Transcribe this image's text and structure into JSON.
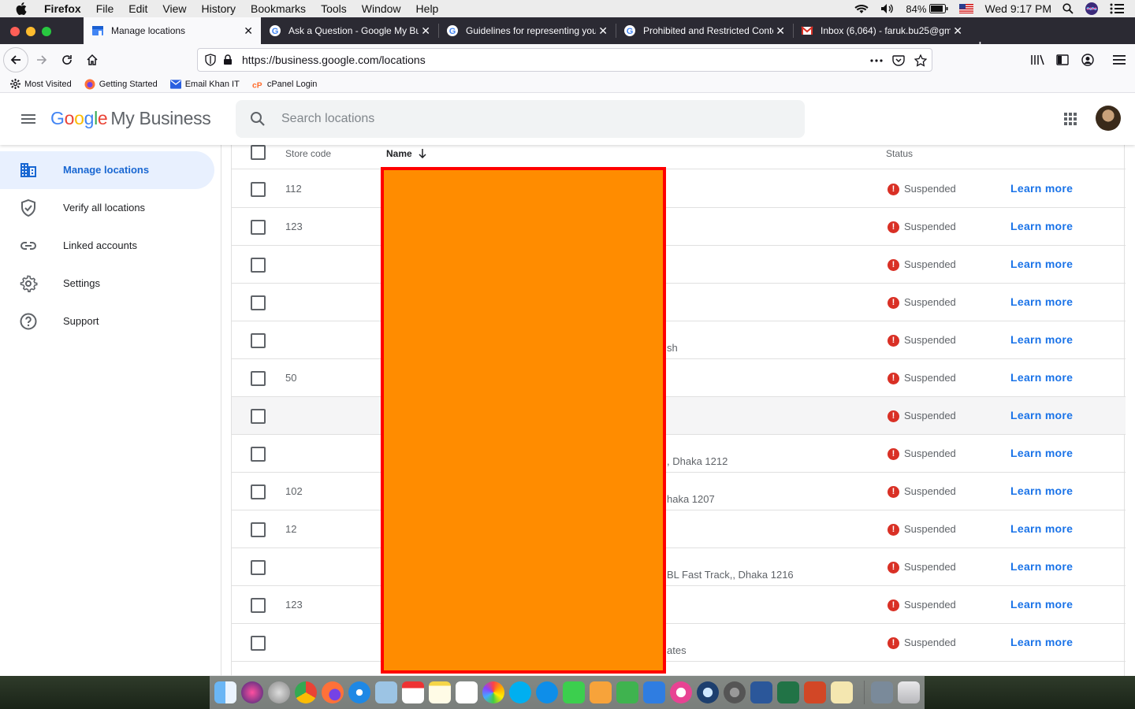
{
  "menubar": {
    "app": "Firefox",
    "items": [
      "File",
      "Edit",
      "View",
      "History",
      "Bookmarks",
      "Tools",
      "Window",
      "Help"
    ],
    "battery": "84%",
    "clock": "Wed 9:17 PM"
  },
  "tabs": [
    {
      "title": "Manage locations",
      "icon": "gmb-icon"
    },
    {
      "title": "Ask a Question - Google My Bu",
      "icon": "google-icon"
    },
    {
      "title": "Guidelines for representing you",
      "icon": "google-icon"
    },
    {
      "title": "Prohibited and Restricted Conte",
      "icon": "google-icon"
    },
    {
      "title": "Inbox (6,064) - faruk.bu25@gm",
      "icon": "gmail-icon"
    }
  ],
  "urlbar": {
    "url": "https://business.google.com/locations"
  },
  "bookmarks": [
    "Most Visited",
    "Getting Started",
    "Email Khan IT",
    "cPanel Login"
  ],
  "header": {
    "logo_google": "Google",
    "logo_product": "My Business",
    "search_placeholder": "Search locations"
  },
  "sidebar": {
    "items": [
      {
        "label": "Manage locations",
        "icon": "building-icon"
      },
      {
        "label": "Verify all locations",
        "icon": "shield-check-icon"
      },
      {
        "label": "Linked accounts",
        "icon": "link-icon"
      },
      {
        "label": "Settings",
        "icon": "gear-icon"
      },
      {
        "label": "Support",
        "icon": "help-icon"
      }
    ]
  },
  "table": {
    "columns": {
      "store_code": "Store code",
      "name": "Name",
      "status": "Status"
    },
    "rows": [
      {
        "code": "112",
        "addr": "",
        "status": "Suspended",
        "action": "Learn more"
      },
      {
        "code": "123",
        "addr": "",
        "status": "Suspended",
        "action": "Learn more"
      },
      {
        "code": "",
        "addr": "",
        "status": "Suspended",
        "action": "Learn more"
      },
      {
        "code": "",
        "addr": "",
        "status": "Suspended",
        "action": "Learn more"
      },
      {
        "code": "",
        "addr": "sh",
        "status": "Suspended",
        "action": "Learn more"
      },
      {
        "code": "50",
        "addr": "",
        "status": "Suspended",
        "action": "Learn more"
      },
      {
        "code": "",
        "addr": "",
        "status": "Suspended",
        "action": "Learn more"
      },
      {
        "code": "",
        "addr": ", Dhaka 1212",
        "status": "Suspended",
        "action": "Learn more"
      },
      {
        "code": "102",
        "addr": "haka 1207",
        "status": "Suspended",
        "action": "Learn more"
      },
      {
        "code": "12",
        "addr": "",
        "status": "Suspended",
        "action": "Learn more"
      },
      {
        "code": "",
        "addr": "BL Fast Track,, Dhaka 1216",
        "status": "Suspended",
        "action": "Learn more"
      },
      {
        "code": "123",
        "addr": "",
        "status": "Suspended",
        "action": "Learn more"
      },
      {
        "code": "",
        "addr": "ates",
        "status": "Suspended",
        "action": "Learn more"
      }
    ]
  },
  "colors": {
    "accent": "#1a73e8",
    "status_error": "#d93025",
    "redaction": "#ff8c00",
    "redaction_border": "#ff0000"
  }
}
